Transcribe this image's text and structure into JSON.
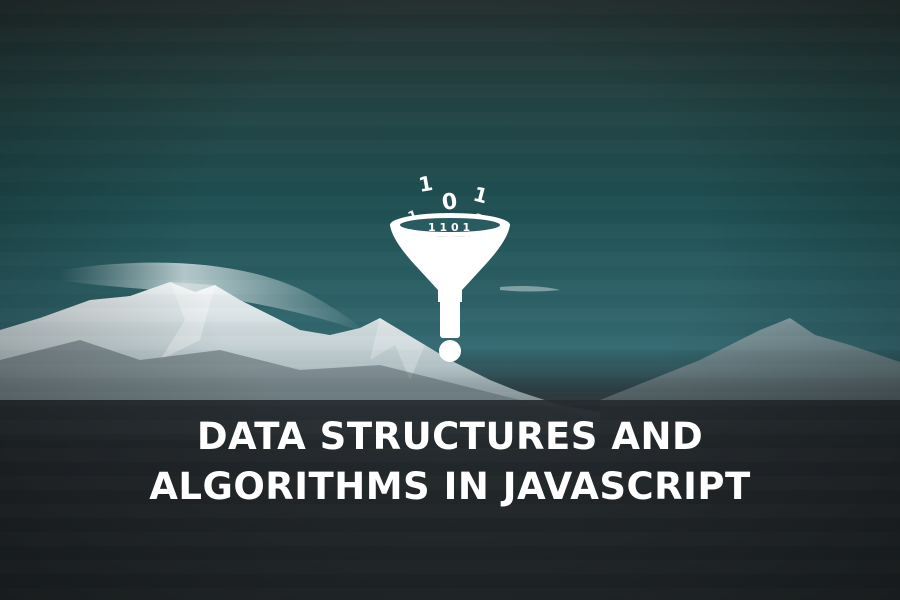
{
  "cover": {
    "title_line1": "DATA STRUCTURES AND",
    "title_line2": "ALGORITHMS IN JAVASCRIPT",
    "logo_icon": "funnel-binary-icon",
    "binary_top": "1",
    "binary_middle": "0",
    "binary_right": "1"
  },
  "colors": {
    "sky_top": "#24302f",
    "sky_mid": "#1f4f52",
    "mountain": "#e6ecee",
    "ground": "#23292c",
    "text": "#ffffff"
  }
}
